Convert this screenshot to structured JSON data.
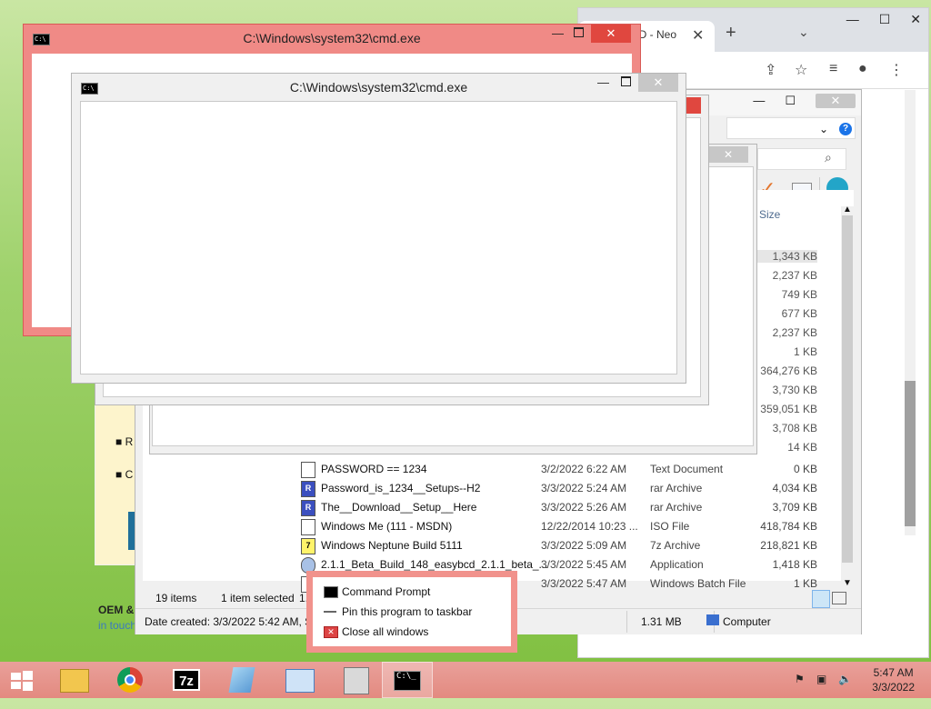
{
  "chrome": {
    "tab_title": "CD - Neo",
    "newtab_symbol": "+",
    "icons": [
      "share-icon",
      "star-icon",
      "reading-list-icon",
      "profile-icon",
      "menu-icon"
    ],
    "page_oem": "OEM &",
    "page_intouch": "in touch"
  },
  "webpage_bullets": [
    "R",
    "C"
  ],
  "explorer": {
    "column_size": "Size",
    "sizes_hidden_rows": [
      "1,343 KB",
      "2,237 KB",
      "749 KB",
      "677 KB",
      "2,237 KB",
      "1 KB",
      "364,276 KB",
      "3,730 KB",
      "359,051 KB",
      "3,708 KB",
      "14 KB"
    ],
    "rows": [
      {
        "name": "PASSWORD ==  1234",
        "date": "3/2/2022 6:22 AM",
        "type": "Text Document",
        "size": "0 KB",
        "icon": "text-file-icon"
      },
      {
        "name": "Password_is_1234__Setups--H2",
        "date": "3/3/2022 5:24 AM",
        "type": "rar Archive",
        "size": "4,034 KB",
        "icon": "rar-archive-icon"
      },
      {
        "name": "The__Download__Setup__Here",
        "date": "3/3/2022 5:26 AM",
        "type": "rar Archive",
        "size": "3,709 KB",
        "icon": "rar-archive-icon"
      },
      {
        "name": "Windows Me (111 - MSDN)",
        "date": "12/22/2014 10:23 ...",
        "type": "ISO File",
        "size": "418,784 KB",
        "icon": "iso-file-icon"
      },
      {
        "name": "Windows Neptune Build 5111",
        "date": "3/3/2022 5:09 AM",
        "type": "7z Archive",
        "size": "218,821 KB",
        "icon": "7z-archive-icon"
      },
      {
        "name": "2.1.1_Beta_Build_148_easybcd_2.1.1_beta_...",
        "date": "3/3/2022 5:45 AM",
        "type": "Application",
        "size": "1,418 KB",
        "icon": "application-icon"
      },
      {
        "name": "",
        "date": "3/3/2022 5:47 AM",
        "type": "Windows Batch File",
        "size": "1 KB",
        "icon": "batch-file-icon"
      }
    ],
    "status_items": "19 items",
    "status_selected": "1 item selected",
    "status_size_partial": "1.3",
    "details_date_created": "Date created: 3/3/2022 5:42 AM, Si",
    "details_size": "1.31 MB",
    "details_location": "Computer"
  },
  "cmd_windows": [
    {
      "title": "C:\\Windows\\system32\\cmd.exe"
    },
    {
      "title": "C:\\Windows\\system32\\cmd.exe"
    }
  ],
  "jumplist": {
    "items": [
      {
        "label": "Command Prompt",
        "icon": "cmd-icon"
      },
      {
        "label": "Pin this program to taskbar",
        "icon": "pin-icon"
      },
      {
        "label": "Close all windows",
        "icon": "close-icon"
      }
    ]
  },
  "taskbar": {
    "apps": [
      "File Explorer",
      "Google Chrome",
      "7-Zip",
      "Notepad",
      "Control Panel",
      "Installer",
      "Command Prompt"
    ],
    "clock_time": "5:47 AM",
    "clock_date": "3/3/2022"
  },
  "colors": {
    "active_window": "#f08a86",
    "taskbar": "#e38a80",
    "close_red": "#e0473f"
  }
}
